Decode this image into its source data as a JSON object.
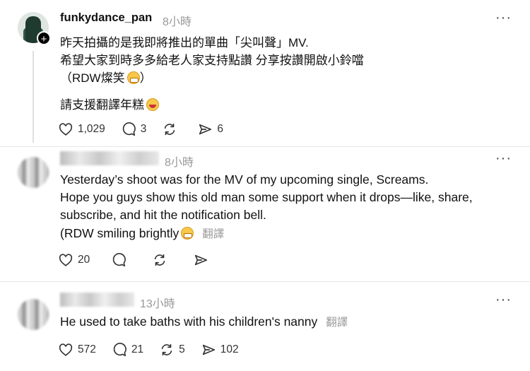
{
  "post": {
    "username": "funkydance_pan",
    "time": "8小時",
    "more": "···",
    "lines": [
      "昨天拍攝的是我即將推出的單曲「尖叫聲」MV.",
      "希望大家到時多多給老人家支持點讚 分享按讚開啟小鈴噹",
      "（RDW燦笑",
      "）",
      "請支援翻譯年糕"
    ],
    "likes": "1,029",
    "comments": "3",
    "shares": "6"
  },
  "reply1": {
    "time": "8小時",
    "more": "···",
    "lines": [
      "Yesterday’s shoot was for the MV of my upcoming single, Screams.",
      "Hope you guys show this old man some support when it drops—like, share,",
      "subscribe, and hit the notification bell.",
      "(RDW smiling brightly"
    ],
    "translate": "翻譯",
    "likes": "20"
  },
  "reply2": {
    "time": "13小時",
    "more": "···",
    "text": "He used to take baths with his children's nanny",
    "translate": "翻譯",
    "likes": "572",
    "comments": "21",
    "reposts": "5",
    "shares": "102"
  },
  "icons": [
    "heart-icon",
    "comment-icon",
    "repost-icon",
    "share-icon",
    "more-icon",
    "follow-plus-icon"
  ]
}
